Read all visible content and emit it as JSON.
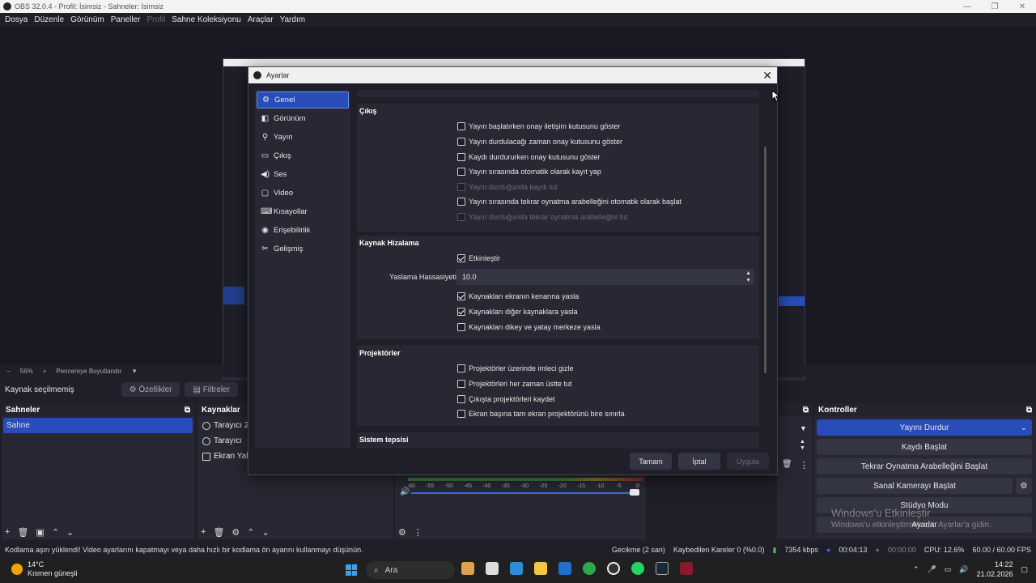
{
  "window": {
    "title": "OBS 32.0.4 - Profil: İsimsiz - Sahneler: İsimsiz"
  },
  "menu": [
    "Dosya",
    "Düzenle",
    "Görünüm",
    "Paneller",
    "Profil",
    "Sahne Koleksiyonu",
    "Araçlar",
    "Yardım"
  ],
  "zoom": {
    "percent": "56%",
    "mode": "Pencereye Boyutlandır"
  },
  "source_bar": {
    "status": "Kaynak seçilmemiş",
    "properties": "Özellikler",
    "filters": "Filtreler"
  },
  "scenes": {
    "title": "Sahneler",
    "items": [
      "Sahne"
    ]
  },
  "sources": {
    "title": "Kaynaklar",
    "items": [
      "Tarayıcı 2",
      "Tarayıcı",
      "Ekran Yaka"
    ]
  },
  "controls": {
    "title": "Kontroller",
    "buttons": [
      "Yayını Durdur",
      "Kaydı Başlat",
      "Tekrar Oynatma Arabelleğini Başlat",
      "Sanal Kamerayı Başlat",
      "Stüdyo Modu",
      "Ayarlar"
    ]
  },
  "mixer": {
    "ticks": [
      "-60",
      "-55",
      "-50",
      "-45",
      "-40",
      "-35",
      "-30",
      "-25",
      "-20",
      "-15",
      "-10",
      "-5",
      "0"
    ],
    "volume_level": 1.0
  },
  "watermark": {
    "line1": "Windows'u Etkinleştir",
    "line2": "Windows'u etkinleştirmek için Ayarlar'a gidin."
  },
  "status": {
    "message": "Kodlama aşırı yüklendi! Video ayarlarını kapatmayı veya daha hızlı bir kodlama ön ayarını kullanmayı düşünün.",
    "delay": "Gecikme (2 san)",
    "dropped": "Kaybedilen Kareler 0 (%0.0)",
    "bitrate": "7354 kbps",
    "stream_time": "00:04:13",
    "rec_time": "00:00:00",
    "cpu": "CPU: 12.6%",
    "fps": "60.00 / 60.00 FPS"
  },
  "taskbar": {
    "temperature": "14°C",
    "weather": "Kısmen güneşli",
    "search": "Ara",
    "time": "14:22",
    "date": "21.02.2026"
  },
  "settings": {
    "title": "Ayarlar",
    "nav": [
      {
        "label": "Genel",
        "icon": "gear-icon"
      },
      {
        "label": "Görünüm",
        "icon": "appearance-icon"
      },
      {
        "label": "Yayın",
        "icon": "antenna-icon"
      },
      {
        "label": "Çıkış",
        "icon": "output-icon"
      },
      {
        "label": "Ses",
        "icon": "speaker-icon"
      },
      {
        "label": "Video",
        "icon": "monitor-icon"
      },
      {
        "label": "Kısayollar",
        "icon": "keyboard-icon"
      },
      {
        "label": "Erişebilirlik",
        "icon": "accessibility-icon"
      },
      {
        "label": "Gelişmiş",
        "icon": "tools-icon"
      }
    ],
    "output": {
      "title": "Çıkış",
      "options": [
        {
          "label": "Yayın başlatırken onay iletişim kutusunu göster",
          "checked": false,
          "enabled": true
        },
        {
          "label": "Yayın durdulacağı zaman onay kutusunu göster",
          "checked": false,
          "enabled": true
        },
        {
          "label": "Kaydı durdururken onay kutusunu göster",
          "checked": false,
          "enabled": true
        },
        {
          "label": "Yayın sırasında otomatik olarak kayıt yap",
          "checked": false,
          "enabled": true
        },
        {
          "label": "Yayın durduğunda kaydı tut",
          "checked": false,
          "enabled": false
        },
        {
          "label": "Yayın sırasında tekrar oynatma arabelleğini otomatik olarak başlat",
          "checked": false,
          "enabled": true
        },
        {
          "label": "Yayın durduğunda tekrar oynatma arabelleğini tut",
          "checked": false,
          "enabled": false
        }
      ]
    },
    "snapping": {
      "title": "Kaynak Hizalama",
      "enable": "Etkinleştir",
      "sensitivity_label": "Yaslama Hassasiyeti",
      "sensitivity_value": "10.0",
      "options": [
        {
          "label": "Kaynakları ekranın kenarına yasla",
          "checked": true
        },
        {
          "label": "Kaynakları diğer kaynaklara yasla",
          "checked": true
        },
        {
          "label": "Kaynakları dikey ve yatay merkeze yasla",
          "checked": false
        }
      ]
    },
    "projectors": {
      "title": "Projektörler",
      "options": [
        {
          "label": "Projektörler üzerinde imleci gizle",
          "checked": false
        },
        {
          "label": "Projektörleri her zaman üstte tut",
          "checked": false
        },
        {
          "label": "Çıkışta projektörleri kaydet",
          "checked": false
        },
        {
          "label": "Ekran başına tam ekran projektörünü bire sınırla",
          "checked": false
        }
      ]
    },
    "tray_title": "Sistem tepsisi",
    "buttons": {
      "ok": "Tamam",
      "cancel": "İptal",
      "apply": "Uygula"
    }
  },
  "colors": {
    "accent": "#284cb8",
    "background": "#1e1f29",
    "panel": "#272833"
  }
}
